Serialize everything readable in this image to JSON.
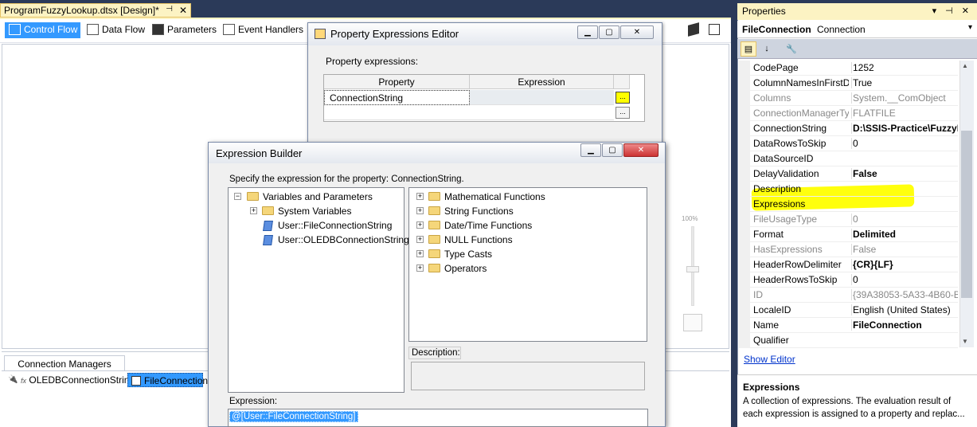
{
  "document_tab": {
    "title": "ProgramFuzzyLookup.dtsx [Design]*",
    "pin": "⊣",
    "close": "✕"
  },
  "designer_tabs": [
    {
      "label": "Control Flow"
    },
    {
      "label": "Data Flow"
    },
    {
      "label": "Parameters"
    },
    {
      "label": "Event Handlers"
    }
  ],
  "zoom": {
    "label": "100%"
  },
  "connection_managers": {
    "tab_label": "Connection Managers",
    "items": [
      {
        "label": "OLEDBConnectionString",
        "prefix": "fx"
      },
      {
        "label": "FileConnection"
      }
    ]
  },
  "properties": {
    "title": "Properties",
    "title_buttons": "▾ ⊣ ✕",
    "object_name": "FileConnection",
    "object_type": "Connection",
    "rows": [
      {
        "key": "CodePage",
        "value": "1252",
        "state": "normal"
      },
      {
        "key": "ColumnNamesInFirstD",
        "value": "True",
        "state": "normal"
      },
      {
        "key": "Columns",
        "value": "System.__ComObject",
        "state": "disabled"
      },
      {
        "key": "ConnectionManagerTy",
        "value": "FLATFILE",
        "state": "disabled"
      },
      {
        "key": "ConnectionString",
        "value": "D:\\SSIS-Practice\\FuzzyL",
        "state": "bold"
      },
      {
        "key": "DataRowsToSkip",
        "value": "0",
        "state": "normal"
      },
      {
        "key": "DataSourceID",
        "value": "",
        "state": "normal"
      },
      {
        "key": "DelayValidation",
        "value": "False",
        "state": "bold"
      },
      {
        "key": "Description",
        "value": "",
        "state": "normal"
      },
      {
        "key": "Expressions",
        "value": "",
        "state": "normal"
      },
      {
        "key": "FileUsageType",
        "value": "0",
        "state": "disabled"
      },
      {
        "key": "Format",
        "value": "Delimited",
        "state": "bold"
      },
      {
        "key": "HasExpressions",
        "value": "False",
        "state": "disabled"
      },
      {
        "key": "HeaderRowDelimiter",
        "value": "{CR}{LF}",
        "state": "bold"
      },
      {
        "key": "HeaderRowsToSkip",
        "value": "0",
        "state": "normal"
      },
      {
        "key": "ID",
        "value": "{39A38053-5A33-4B60-BB",
        "state": "disabled"
      },
      {
        "key": "LocaleID",
        "value": "English (United States)",
        "state": "normal"
      },
      {
        "key": "Name",
        "value": "FileConnection",
        "state": "bold"
      },
      {
        "key": "Qualifier",
        "value": "",
        "state": "normal"
      }
    ],
    "show_editor_link": "Show Editor",
    "description_title": "Expressions",
    "description_text": "A collection of expressions. The evaluation result of each expression is assigned to a property and replac..."
  },
  "property_expressions_editor": {
    "title": "Property Expressions Editor",
    "label": "Property expressions:",
    "col_property": "Property",
    "col_expression": "Expression",
    "rows": [
      {
        "property": "ConnectionString",
        "expression": ""
      },
      {
        "property": "",
        "expression": ""
      }
    ],
    "ellipsis": "..."
  },
  "expression_builder": {
    "title": "Expression Builder",
    "spec": "Specify the expression for the property: ConnectionString.",
    "left_tree": {
      "root": "Variables and Parameters",
      "children": [
        "System Variables",
        "User::FileConnectionString",
        "User::OLEDBConnectionString"
      ]
    },
    "right_tree": [
      "Mathematical Functions",
      "String Functions",
      "Date/Time Functions",
      "NULL Functions",
      "Type Casts",
      "Operators"
    ],
    "description_label": "Description:",
    "expression_label": "Expression:",
    "expression_value": "@[User::FileConnectionString]"
  },
  "colors": {
    "highlight": "#ffff00",
    "selection": "#3399ff",
    "panel_title": "#fcf3c3"
  }
}
